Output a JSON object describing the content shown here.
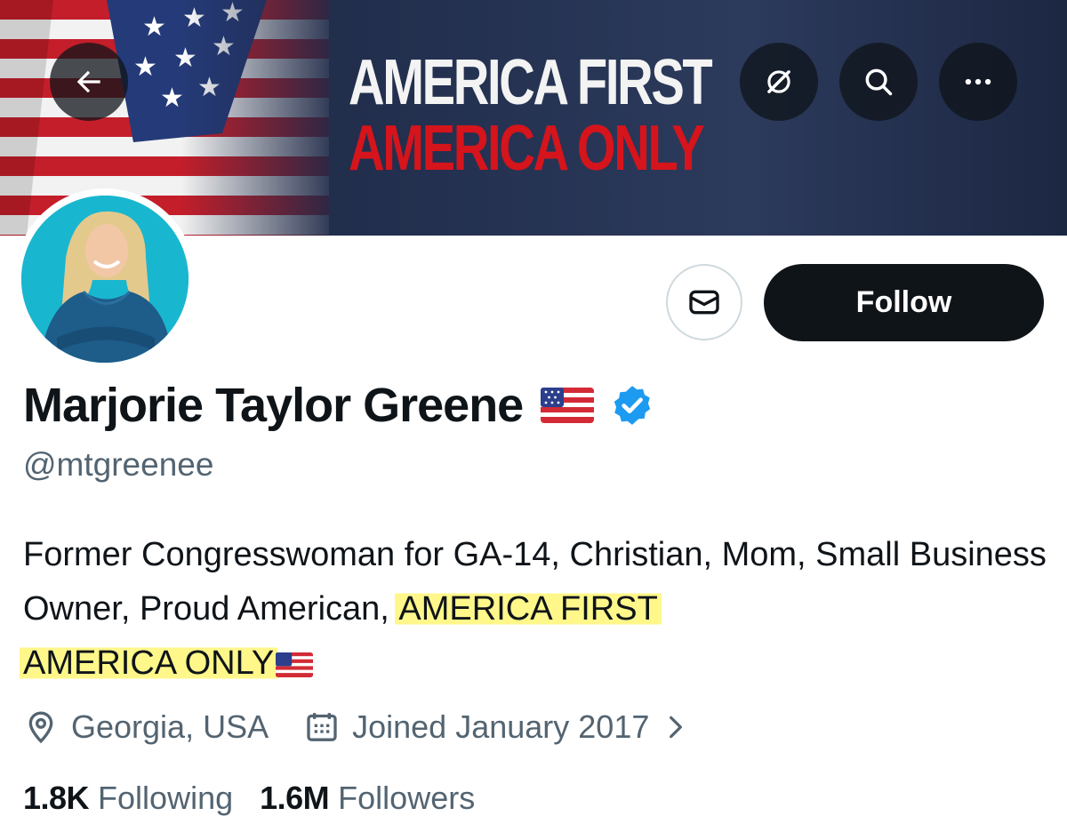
{
  "banner": {
    "line1": "AMERICA FIRST",
    "line2": "AMERICA ONLY",
    "line1_color": "#f3f3f3",
    "line2_color": "#d6141c"
  },
  "header_actions": {
    "back_icon": "arrow-left-icon",
    "grok_icon": "grok-icon",
    "search_icon": "search-icon",
    "more_icon": "more-icon"
  },
  "actions": {
    "message_icon": "envelope-icon",
    "follow_label": "Follow"
  },
  "profile": {
    "name": "Marjorie Taylor Greene",
    "handle": "@mtgreenee",
    "verified": true,
    "verified_color": "#1d9bf0",
    "bio": {
      "part1": "Former Congresswoman for GA-14, Christian, Mom, Small Business Owner, Proud American, ",
      "highlight1": "AMERICA FIRST",
      "highlight2": "AMERICA ONLY"
    },
    "location": "Georgia, USA",
    "joined": "Joined January 2017"
  },
  "stats": {
    "following_count": "1.8K",
    "following_label": "Following",
    "followers_count": "1.6M",
    "followers_label": "Followers"
  },
  "colors": {
    "text_primary": "#0f1419",
    "text_secondary": "#536471",
    "highlight": "#fff78a"
  }
}
